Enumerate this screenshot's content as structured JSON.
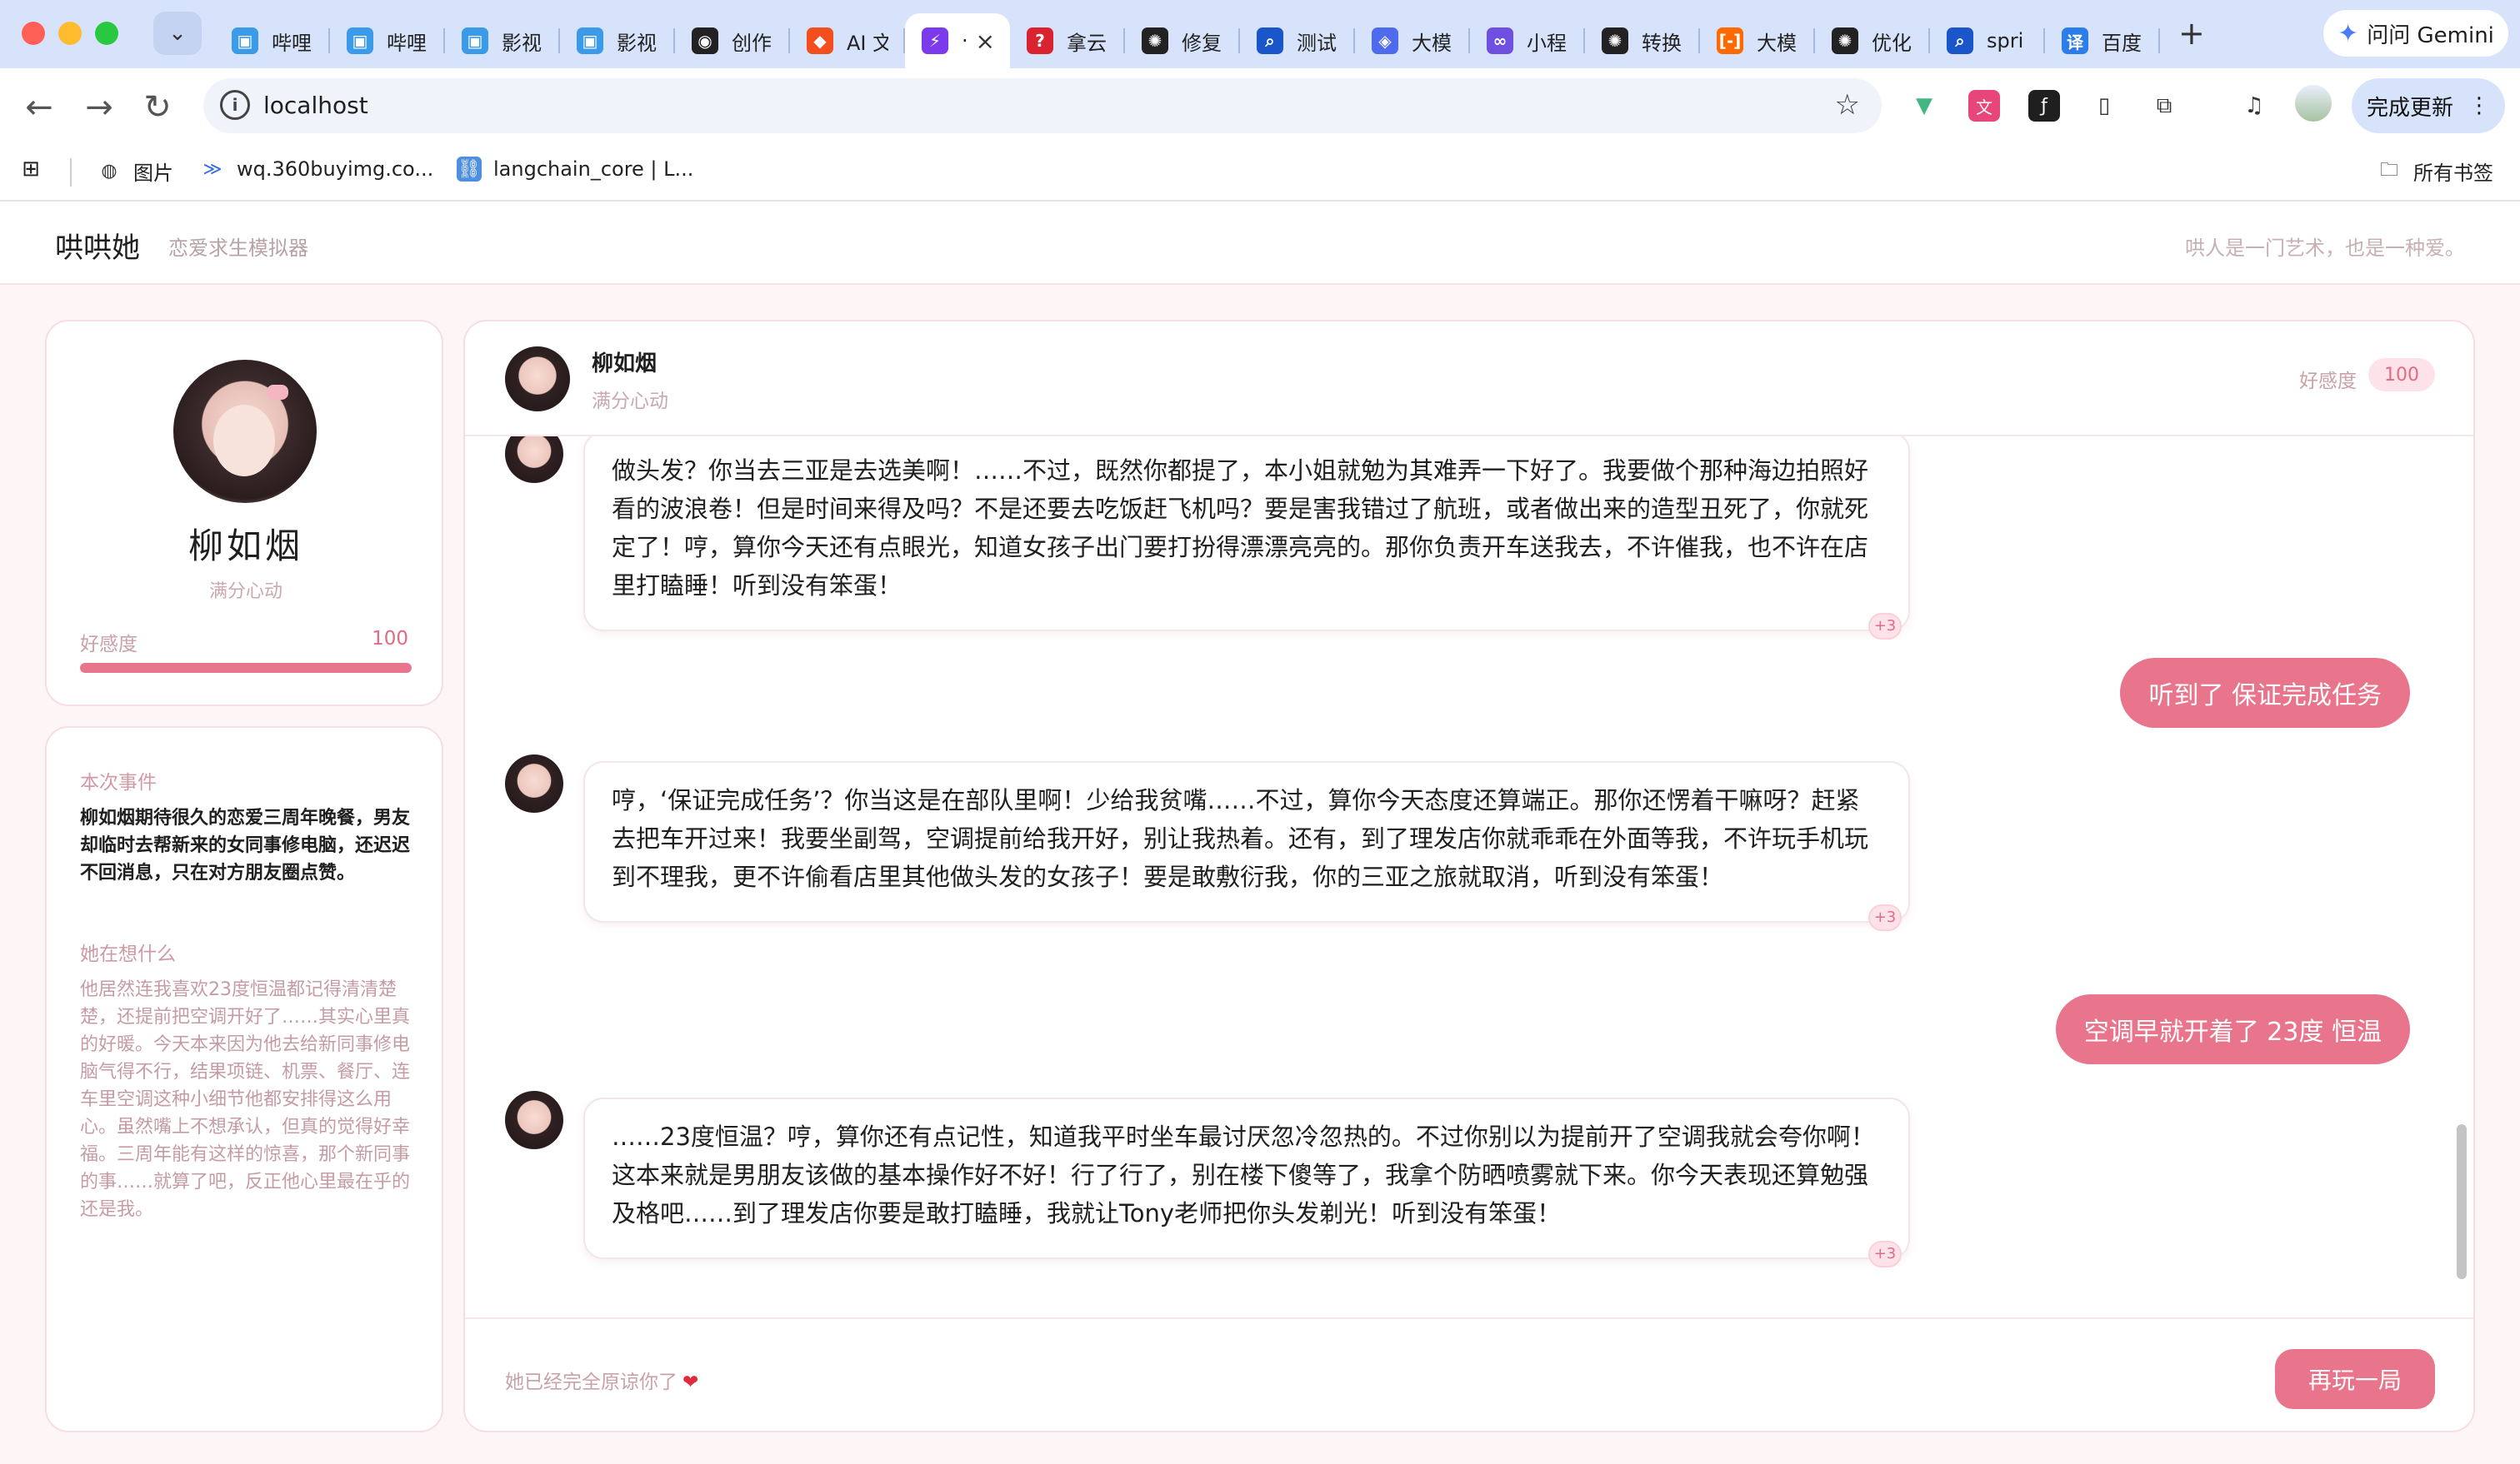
{
  "browser": {
    "tabs": [
      {
        "title": "哔哩",
        "icon": "bilibili-icon",
        "color": "#3b9be8",
        "glyph": "▣"
      },
      {
        "title": "哔哩",
        "icon": "bilibili-icon",
        "color": "#3b9be8",
        "glyph": "▣"
      },
      {
        "title": "影视",
        "icon": "bilibili-icon",
        "color": "#3b9be8",
        "glyph": "▣"
      },
      {
        "title": "影视",
        "icon": "bilibili-icon",
        "color": "#3b9be8",
        "glyph": "▣"
      },
      {
        "title": "创作",
        "icon": "robot-icon",
        "color": "#222222",
        "glyph": "◉"
      },
      {
        "title": "AI 文",
        "icon": "figma-icon",
        "color": "#f24e1e",
        "glyph": "◆"
      },
      {
        "title": "·",
        "icon": "bolt-icon",
        "color": "#7c3aed",
        "glyph": "⚡",
        "active": true
      },
      {
        "title": "拿云",
        "icon": "question-icon",
        "color": "#d9232e",
        "glyph": "?"
      },
      {
        "title": "修复",
        "icon": "openai-icon",
        "color": "#222222",
        "glyph": "✺"
      },
      {
        "title": "测试",
        "icon": "search-icon",
        "color": "#1a55c9",
        "glyph": "⌕"
      },
      {
        "title": "大模",
        "icon": "cube-icon",
        "color": "#4f6bed",
        "glyph": "◈"
      },
      {
        "title": "小程",
        "icon": "link-icon",
        "color": "#6e4fe0",
        "glyph": "∞"
      },
      {
        "title": "转换",
        "icon": "openai-icon",
        "color": "#222222",
        "glyph": "✺"
      },
      {
        "title": "大模",
        "icon": "bracket-icon",
        "color": "#ff6a00",
        "glyph": "[-]"
      },
      {
        "title": "优化",
        "icon": "openai-icon",
        "color": "#222222",
        "glyph": "✺"
      },
      {
        "title": "spri",
        "icon": "search-icon",
        "color": "#1a55c9",
        "glyph": "⌕"
      },
      {
        "title": "百度",
        "icon": "translate-icon",
        "color": "#2b7de9",
        "glyph": "译"
      }
    ],
    "gemini_label": "问问 Gemini",
    "url": "localhost",
    "update_label": "完成更新",
    "bookmarks": [
      {
        "label": "图片",
        "icon": "globe-icon"
      },
      {
        "label": "wq.360buyimg.co...",
        "icon": "chevron-icon"
      },
      {
        "label": "langchain_core | L...",
        "icon": "langchain-icon"
      }
    ],
    "all_bookmarks_label": "所有书签"
  },
  "site": {
    "brand": "哄哄她",
    "brand_sub": "恋爱求生模拟器",
    "slogan": "哄人是一门艺术，也是一种爱。"
  },
  "profile": {
    "name": "柳如烟",
    "status": "满分心动",
    "affection_label": "好感度",
    "affection_value": "100",
    "affection_fraction": 1.0
  },
  "info": {
    "event_title": "本次事件",
    "event_text": "柳如烟期待很久的恋爱三周年晚餐，男友却临时去帮新来的女同事修电脑，还迟迟不回消息，只在对方朋友圈点赞。",
    "thought_title": "她在想什么",
    "thought_text": "他居然连我喜欢23度恒温都记得清清楚楚，还提前把空调开好了……其实心里真的好暖。今天本来因为他去给新同事修电脑气得不行，结果项链、机票、餐厅、连车里空调这种小细节他都安排得这么用心。虽然嘴上不想承认，但真的觉得好幸福。三周年能有这样的惊喜，那个新同事的事……就算了吧，反正他心里最在乎的还是我。"
  },
  "chat": {
    "name": "柳如烟",
    "status": "满分心动",
    "affection_label": "好感度",
    "affection_value": "100",
    "messages": [
      {
        "role": "ai",
        "text": "做头发？你当去三亚是去选美啊！……不过，既然你都提了，本小姐就勉为其难弄一下好了。我要做个那种海边拍照好看的波浪卷！但是时间来得及吗？不是还要去吃饭赶飞机吗？要是害我错过了航班，或者做出来的造型丑死了，你就死定了！哼，算你今天还有点眼光，知道女孩子出门要打扮得漂漂亮亮的。那你负责开车送我去，不许催我，也不许在店里打瞌睡！听到没有笨蛋！",
        "delta": "+3"
      },
      {
        "role": "user",
        "text": "听到了 保证完成任务"
      },
      {
        "role": "ai",
        "text": "哼，‘保证完成任务’？你当这是在部队里啊！少给我贫嘴……不过，算你今天态度还算端正。那你还愣着干嘛呀？赶紧去把车开过来！我要坐副驾，空调提前给我开好，别让我热着。还有，到了理发店你就乖乖在外面等我，不许玩手机玩到不理我，更不许偷看店里其他做头发的女孩子！要是敢敷衍我，你的三亚之旅就取消，听到没有笨蛋！",
        "delta": "+3"
      },
      {
        "role": "user",
        "text": "空调早就开着了 23度 恒温"
      },
      {
        "role": "ai",
        "text": "……23度恒温？哼，算你还有点记性，知道我平时坐车最讨厌忽冷忽热的。不过你别以为提前开了空调我就会夸你啊！这本来就是男朋友该做的基本操作好不好！行了行了，别在楼下傻等了，我拿个防晒喷雾就下来。你今天表现还算勉强及格吧……到了理发店你要是敢打瞌睡，我就让Tony老师把你头发剃光！听到没有笨蛋！",
        "delta": "+3"
      }
    ],
    "footer_text": "她已经完全原谅你了",
    "replay_label": "再玩一局"
  }
}
